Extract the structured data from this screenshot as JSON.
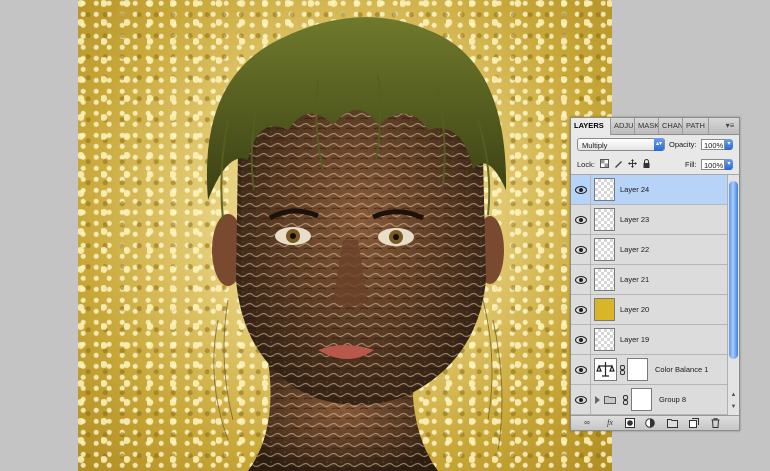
{
  "panel": {
    "tabs": [
      {
        "label": "LAYERS",
        "active": true
      },
      {
        "label": "ADJU",
        "active": false
      },
      {
        "label": "MASK",
        "active": false
      },
      {
        "label": "CHAN",
        "active": false
      },
      {
        "label": "PATH",
        "active": false
      }
    ],
    "menu_icon": "panel-menu-icon",
    "blend_mode": "Multiply",
    "opacity_label": "Opacity:",
    "opacity_value": "100%",
    "lock_label": "Lock:",
    "fill_label": "Fill:",
    "fill_value": "100%",
    "layers": [
      {
        "name": "Layer 24",
        "type": "pixel",
        "selected": true
      },
      {
        "name": "Layer 23",
        "type": "pixel",
        "selected": false
      },
      {
        "name": "Layer 22",
        "type": "pixel",
        "selected": false
      },
      {
        "name": "Layer 21",
        "type": "pixel",
        "selected": false
      },
      {
        "name": "Layer 20",
        "type": "fill-yellow",
        "selected": false
      },
      {
        "name": "Layer 19",
        "type": "pixel",
        "selected": false
      },
      {
        "name": "Color Balance 1",
        "type": "adjustment",
        "selected": false
      },
      {
        "name": "Group 8",
        "type": "group",
        "selected": false
      }
    ],
    "bottom_icons": [
      "link-layers-icon",
      "fx-icon",
      "add-mask-icon",
      "new-adjustment-icon",
      "new-group-icon",
      "new-layer-icon",
      "trash-icon"
    ],
    "colors": {
      "selection": "#b7d3f8",
      "accent": "#2a68d8",
      "layer20_fill": "#d9b52a"
    }
  }
}
